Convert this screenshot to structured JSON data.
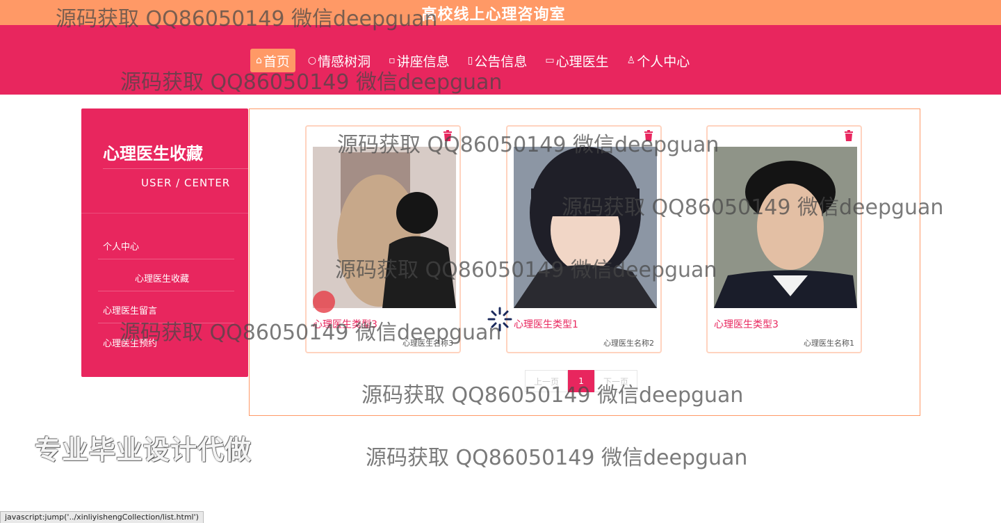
{
  "site": {
    "title": "高校线上心理咨询室"
  },
  "nav": {
    "items": [
      {
        "icon": "home-icon",
        "glyph": "⌂",
        "label": "首页"
      },
      {
        "icon": "circle-icon",
        "glyph": "○",
        "label": "情感树洞"
      },
      {
        "icon": "grid-icon",
        "glyph": "▫",
        "label": "讲座信息"
      },
      {
        "icon": "bookmark-icon",
        "glyph": "▯",
        "label": "公告信息"
      },
      {
        "icon": "book-icon",
        "glyph": "▭",
        "label": "心理医生"
      },
      {
        "icon": "user-icon",
        "glyph": "♙",
        "label": "个人中心"
      }
    ]
  },
  "sidebar": {
    "title": "心理医生收藏",
    "subtitle": "USER / CENTER",
    "items": [
      "个人中心",
      "心理医生收藏",
      "心理医生留言",
      "心理医生预约"
    ]
  },
  "cards": [
    {
      "type": "心理医生类型3",
      "name": "心理医生名称3"
    },
    {
      "type": "心理医生类型1",
      "name": "心理医生名称2"
    },
    {
      "type": "心理医生类型3",
      "name": "心理医生名称1"
    }
  ],
  "pagination": {
    "prev": "上一页",
    "current": "1",
    "next": "下一页"
  },
  "watermark": "源码获取 QQ86050149 微信deepguan",
  "banner": "专业毕业设计代做",
  "statusbar": "javascript:jump('../xinliyishengCollection/list.html')",
  "colors": {
    "primary": "#e8265e",
    "accent": "#ff9966"
  }
}
